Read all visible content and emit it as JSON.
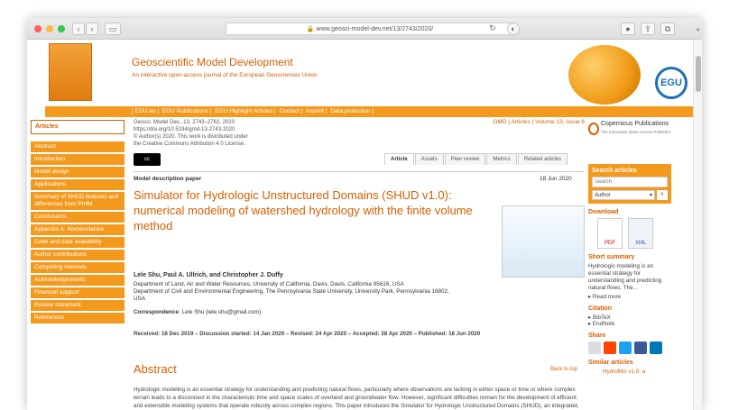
{
  "browser": {
    "url": "www.geosci-model-dev.net/13/2743/2020/"
  },
  "journal": {
    "name": "Geoscientific Model Development",
    "tagline": "An interactive open-access journal of the European Geosciences Union",
    "egu_logo": "EGU"
  },
  "menu": [
    "| EGU.eu |",
    "EGU Publications |",
    "EGU Highlight Articles |",
    "Contact |",
    "Imprint |",
    "Data protection |"
  ],
  "sidebar": {
    "active": "Articles",
    "items": [
      "Abstract",
      "Introduction",
      "Model design",
      "Applications",
      "Summary of SHUD features and differences from PIHM",
      "Conclusions",
      "Appendix A:  Nomenclature",
      "Code and data availability",
      "Author contributions",
      "Competing interests",
      "Acknowledgements",
      "Financial support",
      "Review statement",
      "References"
    ]
  },
  "meta": {
    "line1": "Geosci. Model Dev., 13, 2743–2762, 2020",
    "line2": "https://doi.org/10.5194/gmd-13-2743-2020",
    "line3": "© Author(s) 2020. This work is distributed under",
    "line4": "the Creative Commons Attribution 4.0 License.",
    "issue": "GMD | Articles | Volume 13, issue 6",
    "cc": "cc"
  },
  "tabs": [
    "Article",
    "Assets",
    "Peer review",
    "Metrics",
    "Related articles"
  ],
  "article": {
    "type": "Model description paper",
    "date": "18 Jun 2020",
    "title": "Simulator for Hydrologic Unstructured Domains (SHUD v1.0): numerical modeling of watershed hydrology with the finite volume method",
    "authors": "Lele Shu, Paul A. Ullrich, and Christopher J. Duffy",
    "aff1": "Department of Land, Air and Water Resources, University of California, Davis, Davis, California 95616, USA",
    "aff2": "Department of Civil and Environmental Engineering, The Pennsylvania State University, University Park, Pennsylvania 16802, USA",
    "corr_label": "Correspondence",
    "corr": ": Lele Shu (lele.shu@gmail.com)",
    "dates": "Received: 18 Dec 2019 – Discussion started: 14 Jan 2020 – Revised: 24 Apr 2020 – Accepted: 28 Apr 2020 – Published: 18 Jun 2020",
    "abstract_h": "Abstract",
    "back": "Back to top",
    "abstract": "Hydrologic modeling is an essential strategy for understanding and predicting natural flows, particularly where observations are lacking in either space or time or where complex terrain leads to a disconnect in the characteristic time and space scales of overland and groundwater flow. However, significant difficulties remain for the development of efficient and extensible modeling systems that operate robustly across complex regions. This paper introduces the Simulator for Hydrologic Unstructured Domains (SHUD), an integrated, multiprocess, multiscale, flexible-time-step model, in which hydrologic processes are fully coupled using the finite volume method. SHUD integrates overland flow,"
  },
  "right": {
    "publisher": "Copernicus Publications",
    "publisher_sub": "The Innovative Open Access Publisher",
    "search_h": "Search articles",
    "search_ph": "Search",
    "select": "Author",
    "download": "Download",
    "pdf": "PDF",
    "xml": "XML",
    "short_h": "Short summary",
    "short": "Hydrologic modeling is an essential strategy for understanding and predicting natural flows. The...",
    "readmore": "▸ Read more",
    "citation": "Citation",
    "bibtex": "▸ BibTeX",
    "endnote": "▸ EndNote",
    "share": "Share",
    "similar": "Similar articles",
    "sim1": "HydroMix v1.0: a"
  }
}
